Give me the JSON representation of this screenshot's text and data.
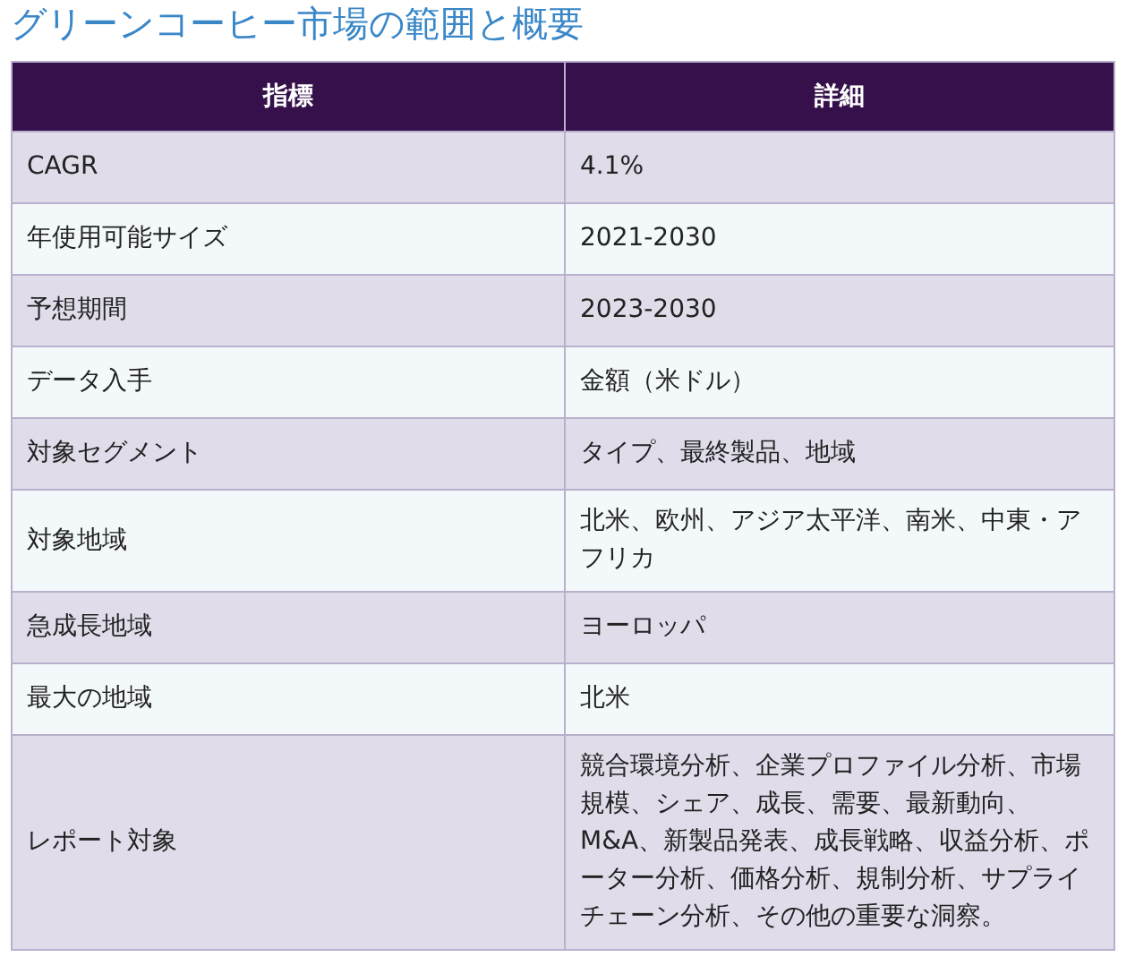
{
  "title": "グリーンコーヒー市場の範囲と概要",
  "table": {
    "columns": [
      "指標",
      "詳細"
    ],
    "rows": [
      [
        "CAGR",
        "4.1%"
      ],
      [
        "年使用可能サイズ",
        "2021-2030"
      ],
      [
        "予想期間",
        "2023-2030"
      ],
      [
        "データ入手",
        "金額（米ドル）"
      ],
      [
        "対象セグメント",
        "タイプ、最終製品、地域"
      ],
      [
        "対象地域",
        "北米、欧州、アジア太平洋、南米、中東・アフリカ"
      ],
      [
        "急成長地域",
        "ヨーロッパ"
      ],
      [
        "最大の地域",
        "北米"
      ],
      [
        "レポート対象",
        "競合環境分析、企業プロファイル分析、市場規模、シェア、成長、需要、最新動向、M&A、新製品発表、成長戦略、収益分析、ポーター分析、価格分析、規制分析、サプライチェーン分析、その他の重要な洞察。"
      ]
    ]
  }
}
